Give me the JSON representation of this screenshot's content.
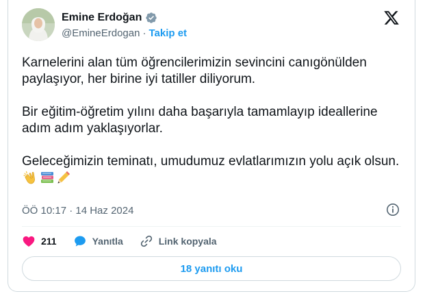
{
  "author": {
    "display_name": "Emine Erdoğan",
    "handle": "@EmineErdogan",
    "separator": "·",
    "follow_label": "Takip et",
    "verified_color": "#829aab"
  },
  "tweet": {
    "paragraphs": [
      "Karnelerini alan tüm öğrencilerimizin sevincini canıgönülden paylaşıyor, her birine iyi tatiller diliyorum.",
      "Bir eğitim-öğretim yılını daha başarıyla tamamlayıp ideallerine adım adım yaklaşıyorlar.",
      "Geleceğimizin teminatı, umudumuz evlatlarımızın yolu açık olsun."
    ],
    "emojis": [
      "clapping-hands",
      "books",
      "pencil"
    ],
    "timestamp": "ÖÖ 10:17 · 14 Haz 2024"
  },
  "actions": {
    "like_count": "211",
    "reply_label": "Yanıtla",
    "copy_link_label": "Link kopyala"
  },
  "read_replies_label": "18 yanıtı oku",
  "colors": {
    "accent": "#1d9bf0",
    "like": "#f91880",
    "text": "#0f1419",
    "muted": "#536471"
  }
}
